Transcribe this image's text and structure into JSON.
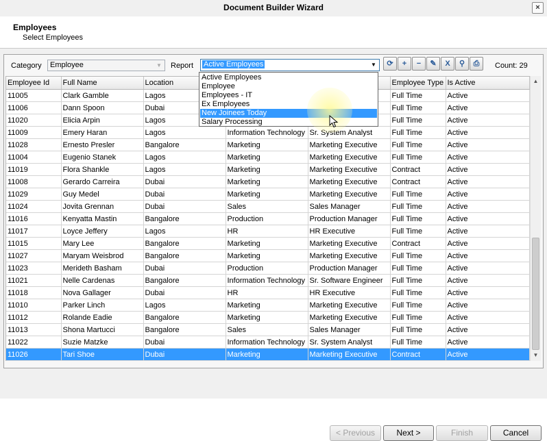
{
  "window": {
    "title": "Document Builder Wizard",
    "close_glyph": "×"
  },
  "header": {
    "title": "Employees",
    "subtitle": "Select Employees"
  },
  "filters": {
    "category_label": "Category",
    "category_value": "Employee",
    "report_label": "Report",
    "report_value": "Active Employees",
    "count_text": "Count: 29"
  },
  "toolbar": [
    {
      "name": "refresh-icon",
      "glyph": "⟳"
    },
    {
      "name": "add-icon",
      "glyph": "+"
    },
    {
      "name": "remove-icon",
      "glyph": "−"
    },
    {
      "name": "edit-icon",
      "glyph": "✎"
    },
    {
      "name": "excel-export-icon",
      "glyph": "X"
    },
    {
      "name": "search-icon",
      "glyph": "⚲"
    },
    {
      "name": "print-icon",
      "glyph": "⎙"
    }
  ],
  "dropdown": {
    "items": [
      "Active Employees",
      "Employee",
      "Employees - IT",
      "Ex Employees",
      "New Joinees Today",
      "Salary Processing"
    ],
    "highlighted_index": 4
  },
  "grid": {
    "columns": [
      "Employee Id",
      "Full Name",
      "Location",
      "Department",
      "Designation",
      "Employee Type",
      "Is Active"
    ],
    "rows": [
      [
        "11005",
        "Clark Gamble",
        "Lagos",
        "",
        "",
        "Full Time",
        "Active"
      ],
      [
        "11006",
        "Dann Spoon",
        "Dubai",
        "",
        "",
        "Full Time",
        "Active"
      ],
      [
        "11020",
        "Elicia Arpin",
        "Lagos",
        "",
        "",
        "Full Time",
        "Active"
      ],
      [
        "11009",
        "Emery Haran",
        "Lagos",
        "Information Technology",
        "Sr. System Analyst",
        "Full Time",
        "Active"
      ],
      [
        "11028",
        "Ernesto Presler",
        "Bangalore",
        "Marketing",
        "Marketing Executive",
        "Full Time",
        "Active"
      ],
      [
        "11004",
        "Eugenio Stanek",
        "Lagos",
        "Marketing",
        "Marketing Executive",
        "Full Time",
        "Active"
      ],
      [
        "11019",
        "Flora Shankle",
        "Lagos",
        "Marketing",
        "Marketing Executive",
        "Contract",
        "Active"
      ],
      [
        "11008",
        "Gerardo Carreira",
        "Dubai",
        "Marketing",
        "Marketing Executive",
        "Contract",
        "Active"
      ],
      [
        "11029",
        "Guy Medel",
        "Dubai",
        "Marketing",
        "Marketing Executive",
        "Full Time",
        "Active"
      ],
      [
        "11024",
        "Jovita Grennan",
        "Dubai",
        "Sales",
        "Sales Manager",
        "Full Time",
        "Active"
      ],
      [
        "11016",
        "Kenyatta Mastin",
        "Bangalore",
        "Production",
        "Production Manager",
        "Full Time",
        "Active"
      ],
      [
        "11017",
        "Loyce Jeffery",
        "Lagos",
        "HR",
        "HR Executive",
        "Full Time",
        "Active"
      ],
      [
        "11015",
        "Mary Lee",
        "Bangalore",
        "Marketing",
        "Marketing Executive",
        "Contract",
        "Active"
      ],
      [
        "11027",
        "Maryam Weisbrod",
        "Bangalore",
        "Marketing",
        "Marketing Executive",
        "Full Time",
        "Active"
      ],
      [
        "11023",
        "Merideth Basham",
        "Dubai",
        "Production",
        "Production Manager",
        "Full Time",
        "Active"
      ],
      [
        "11021",
        "Nelle Cardenas",
        "Bangalore",
        "Information Technology",
        "Sr. Software Engineer",
        "Full Time",
        "Active"
      ],
      [
        "11018",
        "Nova Gallager",
        "Dubai",
        "HR",
        "HR Executive",
        "Full Time",
        "Active"
      ],
      [
        "11010",
        "Parker Linch",
        "Lagos",
        "Marketing",
        "Marketing Executive",
        "Full Time",
        "Active"
      ],
      [
        "11012",
        "Rolande Eadie",
        "Bangalore",
        "Marketing",
        "Marketing Executive",
        "Full Time",
        "Active"
      ],
      [
        "11013",
        "Shona Martucci",
        "Bangalore",
        "Sales",
        "Sales Manager",
        "Full Time",
        "Active"
      ],
      [
        "11022",
        "Suzie Matzke",
        "Dubai",
        "Information Technology",
        "Sr. System Analyst",
        "Full Time",
        "Active"
      ],
      [
        "11026",
        "Tari Shoe",
        "Dubai",
        "Marketing",
        "Marketing Executive",
        "Contract",
        "Active"
      ]
    ],
    "selected_index": 21
  },
  "footer": {
    "previous_label": "< Previous",
    "next_label": "Next >",
    "finish_label": "Finish",
    "cancel_label": "Cancel"
  }
}
